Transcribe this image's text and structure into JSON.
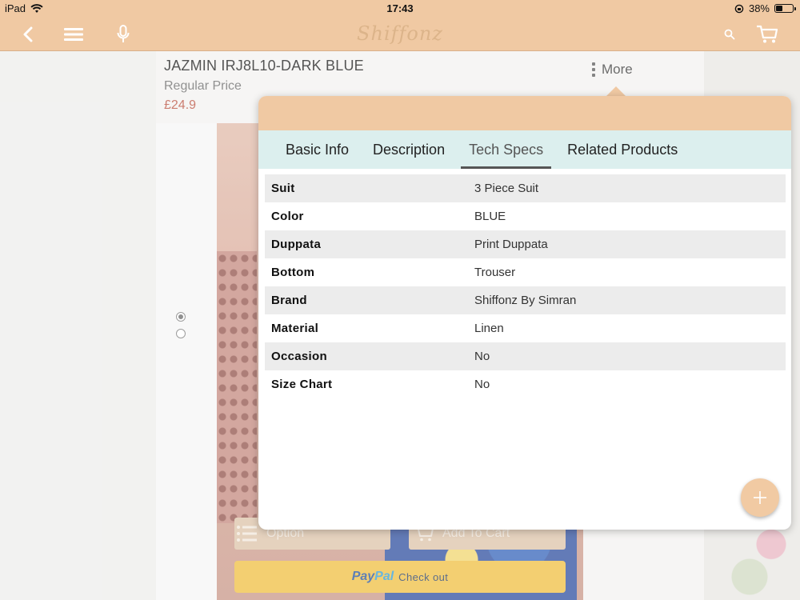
{
  "status_bar": {
    "device": "iPad",
    "time": "17:43",
    "battery": "38%",
    "battery_level": 0.38
  },
  "nav": {
    "logo": "Shiffonz",
    "icons": [
      "back-icon",
      "menu-icon",
      "microphone-icon",
      "search-icon",
      "cart-icon"
    ]
  },
  "product": {
    "title": "JAZMIN IRJ8L10-DARK BLUE",
    "price_label": "Regular Price",
    "price": "£24.9"
  },
  "more_label": "More",
  "popover": {
    "tabs": [
      {
        "label": "Basic Info"
      },
      {
        "label": "Description"
      },
      {
        "label": "Tech Specs"
      },
      {
        "label": "Related Products"
      }
    ],
    "active_tab": "Tech Specs",
    "specs": [
      {
        "key": "Suit",
        "value": "3 Piece Suit"
      },
      {
        "key": "Color",
        "value": "BLUE"
      },
      {
        "key": "Duppata",
        "value": "Print Duppata"
      },
      {
        "key": "Bottom",
        "value": "Trouser"
      },
      {
        "key": "Brand",
        "value": "Shiffonz By Simran"
      },
      {
        "key": "Material",
        "value": "Linen"
      },
      {
        "key": "Occasion",
        "value": "No"
      },
      {
        "key": "Size Chart",
        "value": "No"
      }
    ]
  },
  "actions": {
    "option_label": "Option",
    "add_to_cart_label": "Add To Cart",
    "paypal_brand_a": "Pay",
    "paypal_brand_b": "Pal",
    "paypal_label": "Check out"
  },
  "colors": {
    "header_bg": "#f0c9a3",
    "price": "#b84b3a",
    "tabs_bg": "#dcefee",
    "paypal_yellow": "#efbd3b"
  }
}
